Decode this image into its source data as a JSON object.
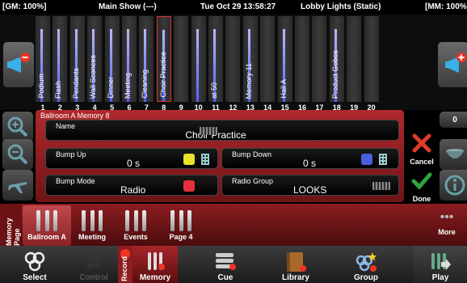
{
  "status": {
    "gm": "[GM: 100%]",
    "show": "Main Show (---)",
    "datetime": "Tue Oct 29 13:58:27",
    "lights": "Lobby Lights (Static)",
    "mm": "[MM: 100%]"
  },
  "faders": [
    {
      "num": "1",
      "label": "Podium",
      "level": 0.85
    },
    {
      "num": "2",
      "label": "Flash",
      "level": 0.85
    },
    {
      "num": "3",
      "label": "Pendants",
      "level": 0.85
    },
    {
      "num": "4",
      "label": "Wall Sconces",
      "level": 0.85
    },
    {
      "num": "5",
      "label": "Dinner",
      "level": 0.85
    },
    {
      "num": "6",
      "label": "Meeting",
      "level": 0.85
    },
    {
      "num": "7",
      "label": "Cleaning",
      "level": 0.85
    },
    {
      "num": "8",
      "label": "Choir Practice",
      "level": 0.85,
      "selected": true
    },
    {
      "num": "9",
      "label": "",
      "level": 0
    },
    {
      "num": "10",
      "label": "",
      "level": 0.85
    },
    {
      "num": "11",
      "label": "at 50",
      "level": 0.85
    },
    {
      "num": "12",
      "label": "",
      "level": 0
    },
    {
      "num": "13",
      "label": "Memory 11",
      "level": 0.85
    },
    {
      "num": "14",
      "label": "",
      "level": 0
    },
    {
      "num": "15",
      "label": "Hall A",
      "level": 0.85
    },
    {
      "num": "16",
      "label": "",
      "level": 0
    },
    {
      "num": "17",
      "label": "",
      "level": 0
    },
    {
      "num": "18",
      "label": "Product Gobos",
      "level": 0.85
    },
    {
      "num": "19",
      "label": "",
      "level": 0
    },
    {
      "num": "20",
      "label": "",
      "level": 0
    }
  ],
  "right_counter": "0",
  "editor": {
    "title": "Ballroom A Memory 8",
    "name_label": "Name",
    "name_value": "Choir Practice",
    "bump_up_label": "Bump Up",
    "bump_up_value": "0 s",
    "bump_down_label": "Bump Down",
    "bump_down_value": "0 s",
    "bump_mode_label": "Bump Mode",
    "bump_mode_value": "Radio",
    "radio_group_label": "Radio Group",
    "radio_group_value": "LOOKS",
    "cancel_label": "Cancel",
    "done_label": "Done"
  },
  "memory_page": {
    "title": "Memory Page",
    "items": [
      "Ballroom A",
      "Meeting",
      "Events",
      "Page 4"
    ],
    "more_label": "More",
    "more_dots": "•••"
  },
  "nav": {
    "select": "Select",
    "control": "Control",
    "record": "Record",
    "memory": "Memory",
    "cue": "Cue",
    "library": "Library",
    "group": "Group",
    "play": "Play"
  },
  "colors": {
    "accent_red": "#b0282c",
    "fader_fill": "#5560ff",
    "cancel": "#e03a2a",
    "done": "#2ea43c"
  }
}
